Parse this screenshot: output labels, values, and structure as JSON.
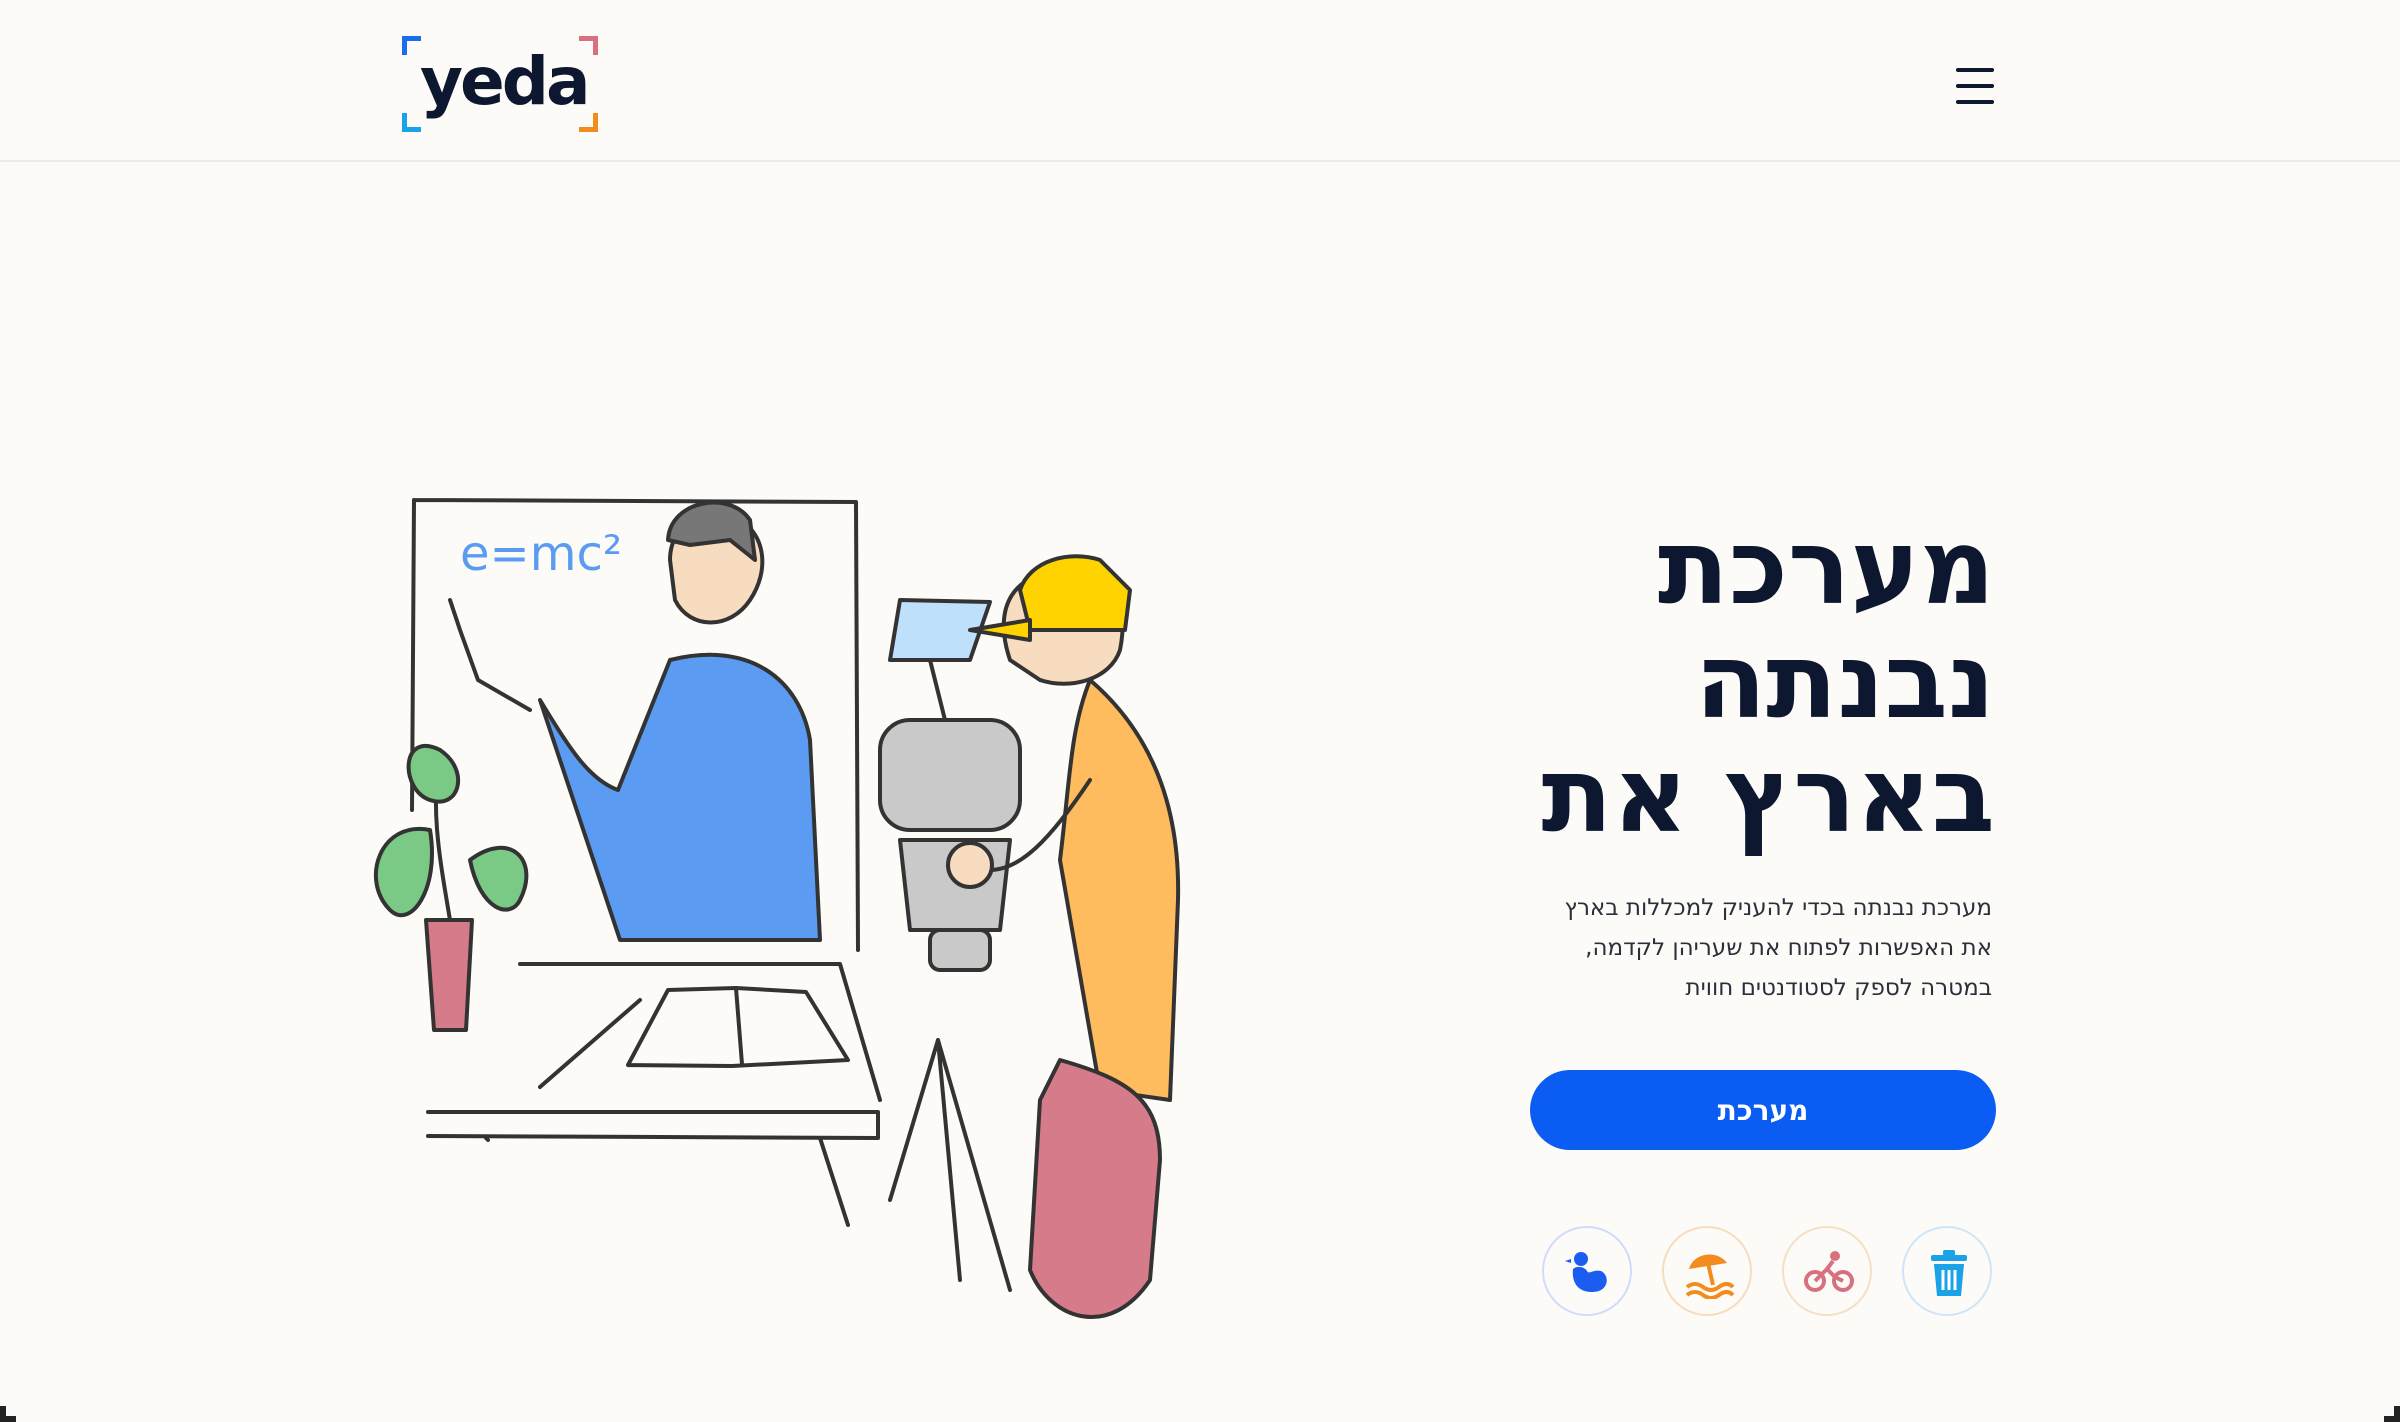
{
  "header": {
    "logo_text": "yeda",
    "logo_colors": {
      "top_left": "#1a6df0",
      "top_right": "#d7707f",
      "bottom_left": "#1aa3e8",
      "bottom_right": "#f28c1e"
    },
    "menu_icon": "hamburger-menu-icon"
  },
  "hero": {
    "title_lines": [
      "מערכת",
      "נבנתה",
      "בארץ את"
    ],
    "description_lines": [
      "מערכת נבנתה בכדי להעניק למכללות בארץ",
      "את האפשרות לפתוח את שעריהן לקדמה,",
      "במטרה לספק לסטודנטים חווית"
    ],
    "cta_label": "מערכת",
    "illustration": "teacher-filmed-by-camera-operator-illustration",
    "illustration_text": "e=mc²"
  },
  "feature_icons": [
    {
      "icon": "trash-icon",
      "color": "#1aa3e8"
    },
    {
      "icon": "bicycle-icon",
      "color": "#d7707f"
    },
    {
      "icon": "beach-umbrella-icon",
      "color": "#f28c1e"
    },
    {
      "icon": "chicken-icon",
      "color": "#1a5df0"
    }
  ],
  "colors": {
    "accent": "#0a5cf2",
    "title": "#0e1730",
    "background": "#fdfbf7"
  }
}
